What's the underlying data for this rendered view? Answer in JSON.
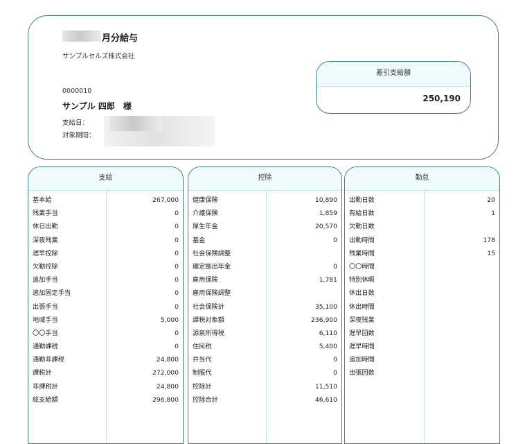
{
  "header": {
    "title": "月分給与",
    "company": "サンプルセルズ株式会社",
    "employee_no": "0000010",
    "employee_name": "サンプル 四郎　様",
    "pay_date_label": "支給日：",
    "period_label": "対象期間："
  },
  "net_pay": {
    "label": "差引支給額",
    "value": "250,190"
  },
  "panels": [
    {
      "title": "支給",
      "rows": [
        {
          "label": "基本給",
          "value": "267,000"
        },
        {
          "label": "残業手当",
          "value": "0"
        },
        {
          "label": "休日出勤",
          "value": "0"
        },
        {
          "label": "深夜残業",
          "value": "0"
        },
        {
          "label": "遅早控除",
          "value": "0"
        },
        {
          "label": "欠勤控除",
          "value": "0"
        },
        {
          "label": "追加手当",
          "value": "0"
        },
        {
          "label": "追加固定手当",
          "value": "0"
        },
        {
          "label": "出張手当",
          "value": "0"
        },
        {
          "label": "地域手当",
          "value": "5,000"
        },
        {
          "label": "〇〇手当",
          "value": "0"
        },
        {
          "label": "通勤課税",
          "value": "0"
        },
        {
          "label": "通勤非課税",
          "value": "24,800"
        },
        {
          "label": "課税計",
          "value": "272,000"
        },
        {
          "label": "非課税計",
          "value": "24,800"
        },
        {
          "label": "総支給額",
          "value": "296,800"
        }
      ]
    },
    {
      "title": "控除",
      "rows": [
        {
          "label": "健康保険",
          "value": "10,890"
        },
        {
          "label": "介護保険",
          "value": "1,859"
        },
        {
          "label": "厚生年金",
          "value": "20,570"
        },
        {
          "label": "基金",
          "value": "0"
        },
        {
          "label": "社会保険調整",
          "value": ""
        },
        {
          "label": "確定拠出年金",
          "value": "0"
        },
        {
          "label": "雇用保険",
          "value": "1,781"
        },
        {
          "label": "雇用保険調整",
          "value": ""
        },
        {
          "label": "社会保険計",
          "value": "35,100"
        },
        {
          "label": "課税対象額",
          "value": "236,900"
        },
        {
          "label": "源泉所得税",
          "value": "6,110"
        },
        {
          "label": "住民税",
          "value": "5,400"
        },
        {
          "label": "弁当代",
          "value": "0"
        },
        {
          "label": "制服代",
          "value": "0"
        },
        {
          "label": "控除計",
          "value": "11,510"
        },
        {
          "label": "控除合計",
          "value": "46,610"
        }
      ]
    },
    {
      "title": "勤怠",
      "rows": [
        {
          "label": "出勤日数",
          "value": "20"
        },
        {
          "label": "有給日数",
          "value": "1"
        },
        {
          "label": "欠勤日数",
          "value": ""
        },
        {
          "label": "出勤時間",
          "value": "178"
        },
        {
          "label": "残業時間",
          "value": "15"
        },
        {
          "label": "〇〇時間",
          "value": ""
        },
        {
          "label": "特別休暇",
          "value": ""
        },
        {
          "label": "休出日数",
          "value": ""
        },
        {
          "label": "休出時間",
          "value": ""
        },
        {
          "label": "深夜残業",
          "value": ""
        },
        {
          "label": "遅早回数",
          "value": ""
        },
        {
          "label": "遅早時間",
          "value": ""
        },
        {
          "label": "追加時間",
          "value": ""
        },
        {
          "label": "出張回数",
          "value": ""
        }
      ]
    }
  ]
}
